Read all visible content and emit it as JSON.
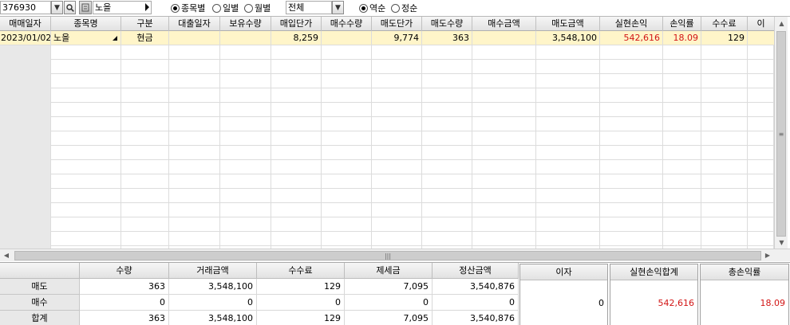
{
  "toolbar": {
    "code": "376930",
    "stock_name": "노을",
    "view_options": [
      {
        "label": "종목별",
        "selected": true
      },
      {
        "label": "일별",
        "selected": false
      },
      {
        "label": "월별",
        "selected": false
      }
    ],
    "filter_select": "전체",
    "sort_options": [
      {
        "label": "역순",
        "selected": true
      },
      {
        "label": "정순",
        "selected": false
      }
    ]
  },
  "grid": {
    "columns": [
      "매매일자",
      "종목명",
      "구분",
      "대출일자",
      "보유수량",
      "매입단가",
      "매수수량",
      "매도단가",
      "매도수량",
      "매수금액",
      "매도금액",
      "실현손익",
      "손익률",
      "수수료",
      "이"
    ],
    "rows": [
      {
        "date": "2023/01/02",
        "name": "노을",
        "type": "현금",
        "loan_date": "",
        "hold_qty": "",
        "buy_price": "8,259",
        "buy_qty": "",
        "sell_price": "9,774",
        "sell_qty": "363",
        "buy_amount": "",
        "sell_amount": "3,548,100",
        "realized_pl": "542,616",
        "pl_rate": "18.09",
        "fee": "129",
        "extra": ""
      }
    ]
  },
  "summary": {
    "headers": [
      "수량",
      "거래금액",
      "수수료",
      "제세금",
      "정산금액"
    ],
    "rows": [
      {
        "label": "매도",
        "values": [
          "363",
          "3,548,100",
          "129",
          "7,095",
          "3,540,876"
        ]
      },
      {
        "label": "매수",
        "values": [
          "0",
          "0",
          "0",
          "0",
          "0"
        ]
      },
      {
        "label": "합계",
        "values": [
          "363",
          "3,548,100",
          "129",
          "7,095",
          "3,540,876"
        ]
      }
    ],
    "interest": {
      "header": "이자",
      "value": "0"
    },
    "realized_total": {
      "header": "실현손익합계",
      "value": "542,616"
    },
    "total_rate": {
      "header": "총손익률",
      "value": "18.09"
    }
  },
  "colors": {
    "accent_red": "#d21414",
    "selected_row": "#fff5c9"
  }
}
